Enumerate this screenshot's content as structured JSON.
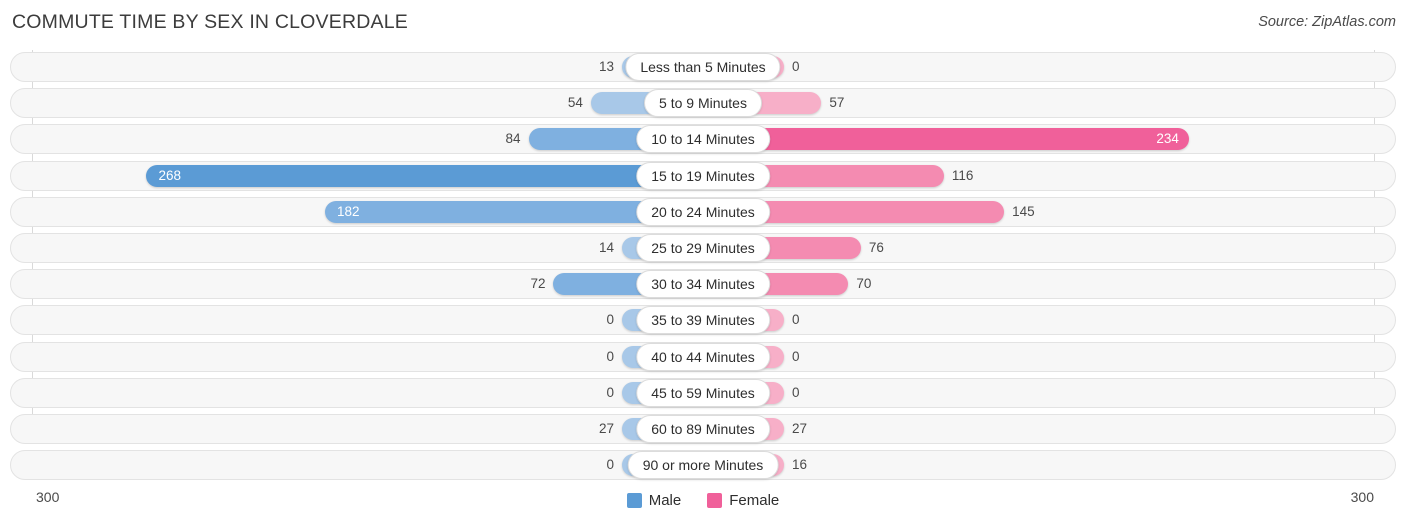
{
  "header": {
    "title": "COMMUTE TIME BY SEX IN CLOVERDALE",
    "source": "Source: ZipAtlas.com"
  },
  "axis": {
    "left_label": "300",
    "right_label": "300"
  },
  "legend": {
    "items": [
      {
        "label": "Male",
        "color": "#5b9bd5"
      },
      {
        "label": "Female",
        "color": "#f0609a"
      }
    ]
  },
  "colors": {
    "male_light": "#a8c8e8",
    "male_mid": "#7fb0e0",
    "male_dark": "#5b9bd5",
    "female_light": "#f7afc8",
    "female_mid": "#f48bb1",
    "female_dark": "#f0609a",
    "track": "#f7f7f7",
    "gridline": "#d9d9d9"
  },
  "chart_data": {
    "type": "bar",
    "subtype": "diverging-bidirectional",
    "title": "COMMUTE TIME BY SEX IN CLOVERDALE",
    "xlabel": "",
    "ylabel": "",
    "xlim": [
      300,
      300
    ],
    "axis_max": 300,
    "grid": true,
    "legend_position": "bottom-center",
    "categories": [
      "Less than 5 Minutes",
      "5 to 9 Minutes",
      "10 to 14 Minutes",
      "15 to 19 Minutes",
      "20 to 24 Minutes",
      "25 to 29 Minutes",
      "30 to 34 Minutes",
      "35 to 39 Minutes",
      "40 to 44 Minutes",
      "45 to 59 Minutes",
      "60 to 89 Minutes",
      "90 or more Minutes"
    ],
    "series": [
      {
        "name": "Male",
        "direction": "left",
        "values": [
          13,
          54,
          84,
          268,
          182,
          14,
          72,
          0,
          0,
          0,
          27,
          0
        ]
      },
      {
        "name": "Female",
        "direction": "right",
        "values": [
          0,
          57,
          234,
          116,
          145,
          76,
          70,
          0,
          0,
          0,
          27,
          16
        ]
      }
    ]
  },
  "rows": [
    {
      "category": "Less than 5 Minutes",
      "male": 13,
      "female": 0,
      "male_text": "13",
      "female_text": "0"
    },
    {
      "category": "5 to 9 Minutes",
      "male": 54,
      "female": 57,
      "male_text": "54",
      "female_text": "57"
    },
    {
      "category": "10 to 14 Minutes",
      "male": 84,
      "female": 234,
      "male_text": "84",
      "female_text": "234"
    },
    {
      "category": "15 to 19 Minutes",
      "male": 268,
      "female": 116,
      "male_text": "268",
      "female_text": "116"
    },
    {
      "category": "20 to 24 Minutes",
      "male": 182,
      "female": 145,
      "male_text": "182",
      "female_text": "145"
    },
    {
      "category": "25 to 29 Minutes",
      "male": 14,
      "female": 76,
      "male_text": "14",
      "female_text": "76"
    },
    {
      "category": "30 to 34 Minutes",
      "male": 72,
      "female": 70,
      "male_text": "72",
      "female_text": "70"
    },
    {
      "category": "35 to 39 Minutes",
      "male": 0,
      "female": 0,
      "male_text": "0",
      "female_text": "0"
    },
    {
      "category": "40 to 44 Minutes",
      "male": 0,
      "female": 0,
      "male_text": "0",
      "female_text": "0"
    },
    {
      "category": "45 to 59 Minutes",
      "male": 0,
      "female": 0,
      "male_text": "0",
      "female_text": "0"
    },
    {
      "category": "60 to 89 Minutes",
      "male": 27,
      "female": 27,
      "male_text": "27",
      "female_text": "27"
    },
    {
      "category": "90 or more Minutes",
      "male": 0,
      "female": 16,
      "male_text": "0",
      "female_text": "16"
    }
  ]
}
